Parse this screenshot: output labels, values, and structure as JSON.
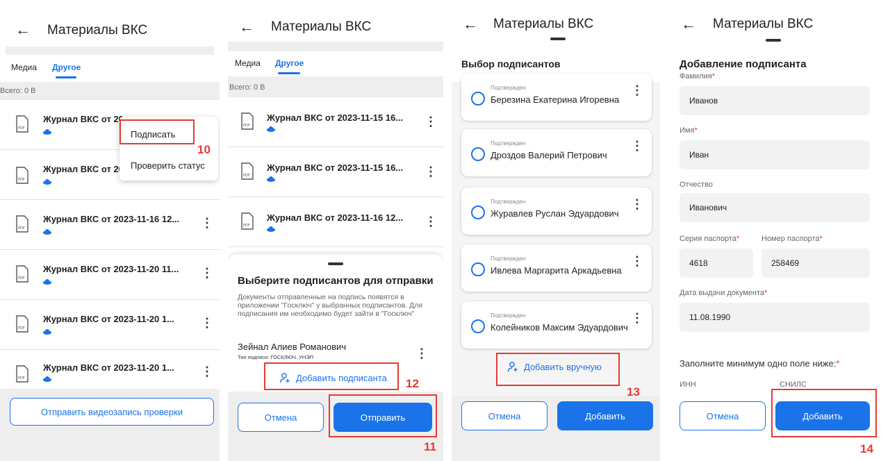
{
  "header": {
    "title": "Материалы ВКС",
    "back_glyph": "←"
  },
  "tabs": {
    "media": "Медиа",
    "other": "Другое"
  },
  "total": "Всего: 0 В",
  "screen1": {
    "files": [
      "Журнал ВКС от 2023-11-15 16...",
      "Журнал ВКС от 2023-11-15 16...",
      "Журнал ВКС от 2023-11-16 12...",
      "Журнал ВКС от 2023-11-20 11...",
      "Журнал ВКС от 2023-11-20 1...",
      "Журнал ВКС от 2023-11-20 1..."
    ],
    "file1_visible": "Журнал ВКС от 20",
    "file2_visible": "Журнал ВКС от 20",
    "menu": {
      "sign": "Подписать",
      "check_status": "Проверить статус"
    },
    "send_video_button": "Отправить видеозапись проверки",
    "step_label": "10"
  },
  "screen2": {
    "files": [
      "Журнал ВКС от 2023-11-15 16...",
      "Журнал ВКС от 2023-11-15 16...",
      "Журнал ВКС от 2023-11-16 12..."
    ],
    "sheet_title": "Выберите подписантов для отправки",
    "description": "Документы отправленные на подпись появятся в приложении \"Госключ\" у выбранных подписантов. Для подписания им необходимо будет зайти в \"Госключ\"",
    "signer_name": "Зейнал Алиев Романович",
    "signer_type": "Тип подписи: ГОСКЛЮЧ. УНЭП",
    "add_signer_button": "Добавить подписанта",
    "cancel_button": "Отмена",
    "send_button": "Отправить",
    "step_add": "12",
    "step_send": "11"
  },
  "screen3": {
    "title": "Выбор подписантов",
    "signers": [
      {
        "status": "Подтвержден",
        "name": "Березина Екатерина Игоревна"
      },
      {
        "status": "Подтвержден",
        "name": "Дроздов Валерий  Петрович"
      },
      {
        "status": "Подтвержден",
        "name": "Журавлев Руслан Эдуардович"
      },
      {
        "status": "Подтвержден",
        "name": "Ивлева Маргарита Аркадьевна"
      },
      {
        "status": "Подтвержден",
        "name": "Колейников Максим Эдуардович"
      }
    ],
    "add_manually_button": "Добавить вручную",
    "cancel_button": "Отмена",
    "add_button": "Добавить",
    "step_label": "13"
  },
  "screen4": {
    "title": "Добавление подписанта",
    "required_mark": "*",
    "fields": {
      "last_name_label": "Фамилия",
      "last_name_value": "Иванов",
      "first_name_label": "Имя",
      "first_name_value": "Иван",
      "patronymic_label": "Отчество",
      "patronymic_value": "Иванович",
      "passport_series_label": "Серия паспорта",
      "passport_series_value": "4618",
      "passport_number_label": "Номер паспорта",
      "passport_number_value": "258469",
      "issue_date_label": "Дата выдачи документа",
      "issue_date_value": "11.08.1990"
    },
    "hint": "Заполните минимум одно поле ниже:",
    "inn_label": "ИНН",
    "snils_label": "СНИЛС",
    "cancel_button": "Отмена",
    "add_button": "Добавить",
    "step_label": "14"
  },
  "colors": {
    "accent": "#1a73e8",
    "highlight": "#e53935"
  }
}
